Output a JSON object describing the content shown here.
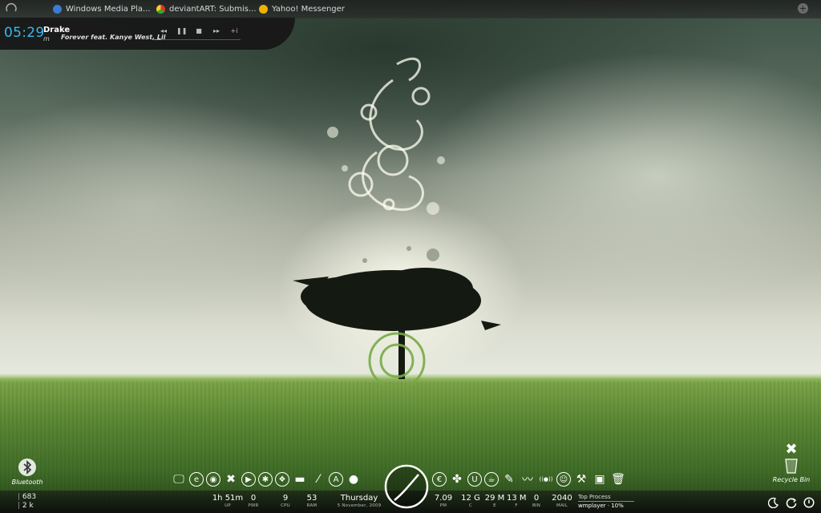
{
  "taskbar": {
    "tasks": [
      {
        "label": "Windows Media Pla...",
        "icon": "windows-media-player-icon",
        "color": "#3a7bd5"
      },
      {
        "label": "deviantART: Submis...",
        "icon": "chrome-icon",
        "color": "#e8b020"
      },
      {
        "label": "Yahoo! Messenger",
        "icon": "yahoo-messenger-icon",
        "color": "#f0b000"
      }
    ],
    "add_label": "+"
  },
  "player": {
    "time": "05:29",
    "artist": "Drake",
    "artist_line2": "m",
    "song": "Forever feat. Kanye West, Lil",
    "controls": {
      "prev": "◂◂",
      "pause": "❚❚",
      "stop": "■",
      "next": "▸▸",
      "extra": "+i"
    },
    "progress": 0.08,
    "accent": "#3ab8e8"
  },
  "desktop": {
    "bluetooth_label": "Bluetooth",
    "recycle_label": "Recycle Bin"
  },
  "network": {
    "up": "683",
    "down": "2 k"
  },
  "stats": [
    {
      "value": "1h 51m",
      "label": "UP"
    },
    {
      "value": "0",
      "label": "PWR"
    },
    {
      "value": "9",
      "label": "CPU"
    },
    {
      "value": "53",
      "label": "RAM"
    },
    {
      "value": "Thursday",
      "label": "5 November, 2009"
    },
    {
      "value": "7.09",
      "label": "PM"
    },
    {
      "value": "12 G",
      "label": "C"
    },
    {
      "value": "29 M",
      "label": "E"
    },
    {
      "value": "13 M",
      "label": "F"
    },
    {
      "value": "0",
      "label": "BIN"
    },
    {
      "value": "2040",
      "label": "MAIL"
    }
  ],
  "top_process": {
    "header": "Top Process",
    "value": "wmplayer · 10%"
  },
  "dock_left": [
    {
      "name": "computer-icon",
      "glyph": "🖵",
      "circ": false
    },
    {
      "name": "internet-explorer-icon",
      "glyph": "e",
      "circ": true
    },
    {
      "name": "chrome-icon",
      "glyph": "◉",
      "circ": true
    },
    {
      "name": "tools-icon",
      "glyph": "✖",
      "circ": false
    },
    {
      "name": "media-player-icon",
      "glyph": "▶",
      "circ": true
    },
    {
      "name": "runner-icon",
      "glyph": "✱",
      "circ": true
    },
    {
      "name": "game-icon",
      "glyph": "❖",
      "circ": true
    },
    {
      "name": "brush-icon",
      "glyph": "▬",
      "circ": false
    },
    {
      "name": "slash-icon",
      "glyph": "⁄",
      "circ": false
    },
    {
      "name": "anarchy-icon",
      "glyph": "A",
      "circ": true
    },
    {
      "name": "bomb-icon",
      "glyph": "●",
      "circ": false
    }
  ],
  "dock_right": [
    {
      "name": "euro-icon",
      "glyph": "€",
      "circ": true
    },
    {
      "name": "bug-icon",
      "glyph": "✤",
      "circ": false
    },
    {
      "name": "u-icon",
      "glyph": "U",
      "circ": true
    },
    {
      "name": "coffee-icon",
      "glyph": "☕",
      "circ": true
    },
    {
      "name": "notepad-icon",
      "glyph": "✎",
      "circ": false
    },
    {
      "name": "chart-icon",
      "glyph": "〰",
      "circ": false
    },
    {
      "name": "wireless-icon",
      "glyph": "((●))",
      "circ": false
    },
    {
      "name": "smiley-icon",
      "glyph": "☺",
      "circ": true
    },
    {
      "name": "settings-tools-icon",
      "glyph": "⚒",
      "circ": false
    },
    {
      "name": "image-icon",
      "glyph": "▣",
      "circ": false
    },
    {
      "name": "trash-icon",
      "glyph": "🗑",
      "circ": false
    }
  ]
}
